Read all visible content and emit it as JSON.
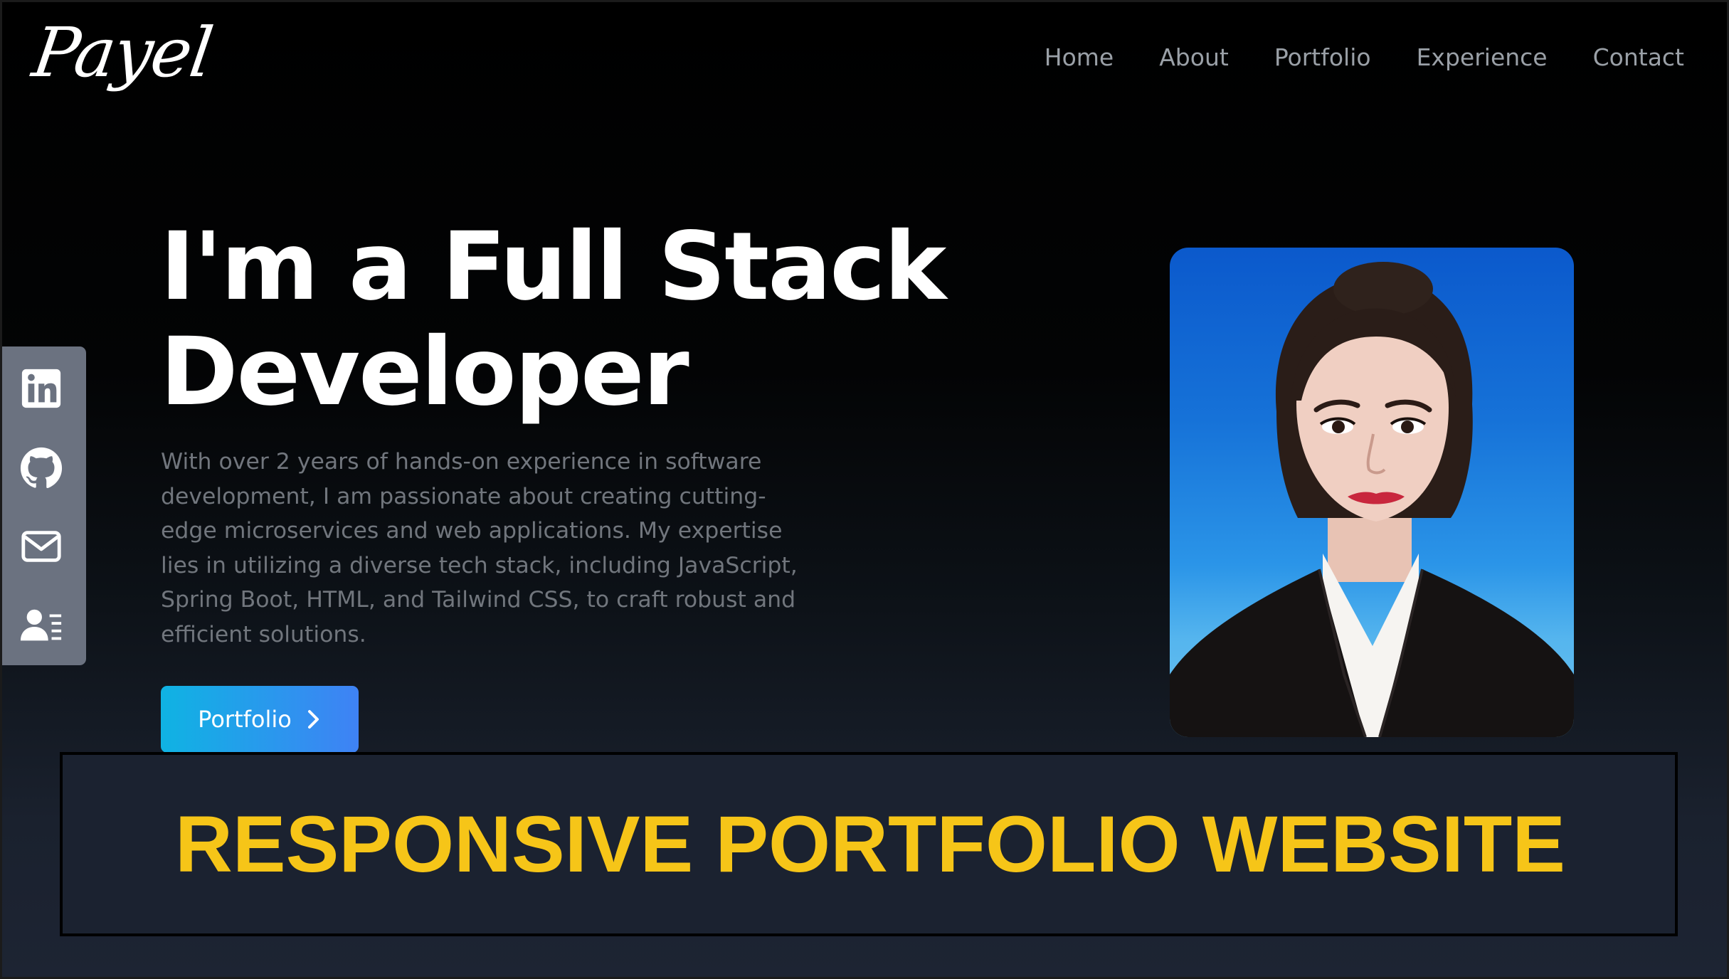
{
  "header": {
    "logo": "Payel",
    "nav": [
      "Home",
      "About",
      "Portfolio",
      "Experience",
      "Contact"
    ]
  },
  "hero": {
    "title_line1": "I'm a Full Stack",
    "title_line2": "Developer",
    "description": "With over 2 years of hands-on experience in software development, I am passionate about creating cutting-edge microservices and web applications. My expertise lies in utilizing a diverse tech stack, including JavaScript, Spring Boot, HTML, and Tailwind CSS, to craft robust and efficient solutions.",
    "button_label": "Portfolio",
    "button_icon": "chevron-right-icon"
  },
  "social": {
    "icons": [
      "linkedin-icon",
      "github-icon",
      "mail-icon",
      "resume-icon"
    ]
  },
  "profile_photo": {
    "subject": "portrait photo"
  },
  "banner": {
    "text": "RESPONSIVE PORTFOLIO WEBSITE"
  },
  "colors": {
    "accent_gradient_start": "#0fb3e3",
    "accent_gradient_end": "#3f82f5",
    "banner_text": "#f6c518",
    "social_bar": "#6b7280",
    "nav_text": "#9aa0a7",
    "description_text": "#71767d"
  }
}
